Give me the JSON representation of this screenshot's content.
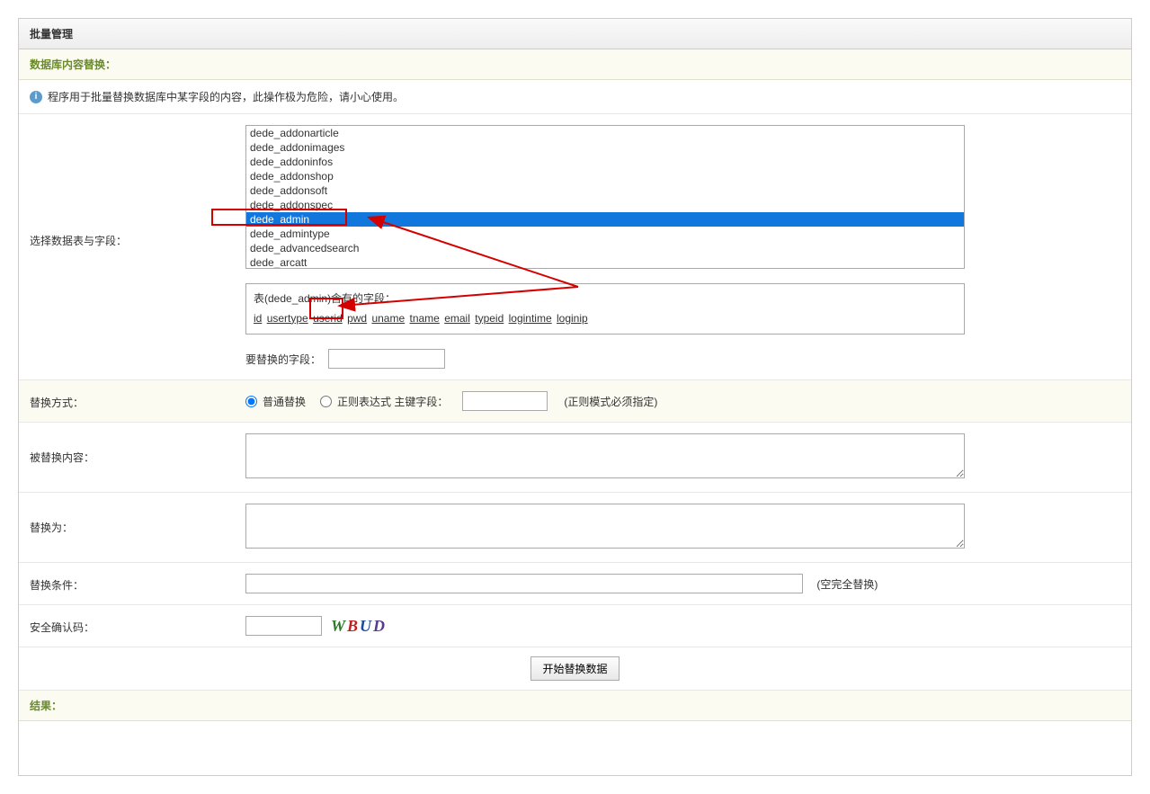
{
  "title": "批量管理",
  "section1": "数据库内容替换：",
  "section_result": "结果：",
  "info_text": "程序用于批量替换数据库中某字段的内容，此操作极为危险，请小心使用。",
  "labels": {
    "select_table": "选择数据表与字段：",
    "replace_method": "替换方式：",
    "replaced_content": "被替换内容：",
    "replace_to": "替换为：",
    "replace_cond": "替换条件：",
    "captcha": "安全确认码：",
    "field_to_replace": "要替换的字段：",
    "normal_replace": "普通替换",
    "regex_replace": "正则表达式 主键字段：",
    "regex_note": "(正则模式必须指定)",
    "cond_note": "(空完全替换)",
    "submit": "开始替换数据"
  },
  "tables": [
    "dede_addonarticle",
    "dede_addonimages",
    "dede_addoninfos",
    "dede_addonshop",
    "dede_addonsoft",
    "dede_addonspec",
    "dede_admin",
    "dede_admintype",
    "dede_advancedsearch",
    "dede_arcatt"
  ],
  "selected_table_idx": 6,
  "field_title_prefix": "表(",
  "field_title_table": "dede_admin",
  "field_title_suffix": ")含有的字段：",
  "fields": [
    "id",
    "usertype",
    "userid",
    "pwd",
    "uname",
    "tname",
    "email",
    "typeid",
    "logintime",
    "loginip"
  ],
  "captcha_chars": [
    "W",
    "B",
    "U",
    "D"
  ]
}
